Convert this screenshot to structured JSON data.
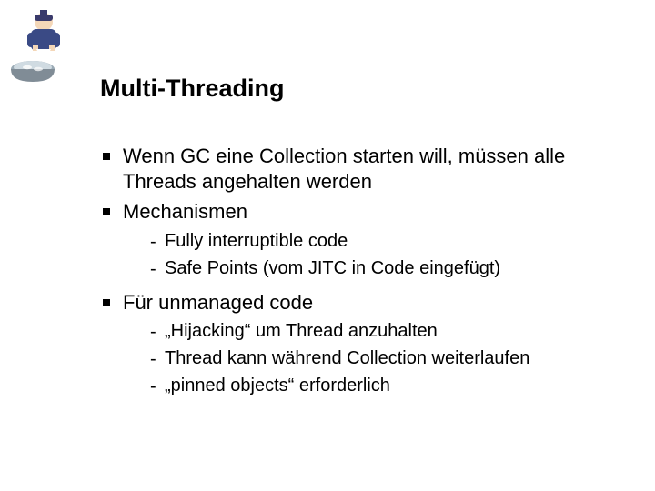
{
  "slide": {
    "title": "Multi-Threading",
    "bullets": {
      "b1": "Wenn GC eine Collection starten will, müssen alle Threads angehalten werden",
      "b2": "Mechanismen",
      "b2_subs": {
        "s1": "Fully interruptible code",
        "s2": "Safe Points (vom JITC in Code eingefügt)"
      },
      "b3": "Für unmanaged code",
      "b3_subs": {
        "s1": "„Hijacking“ um Thread anzuhalten",
        "s2": "Thread kann während Collection weiterlaufen",
        "s3": "„pinned objects“ erforderlich"
      }
    }
  }
}
